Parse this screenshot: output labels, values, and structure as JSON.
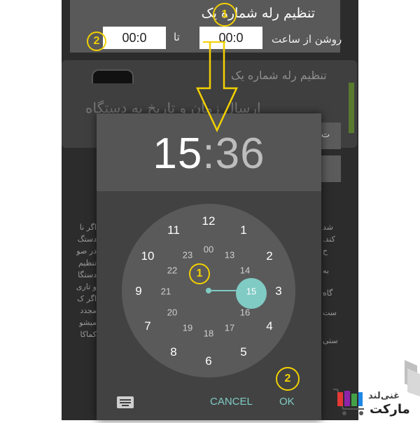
{
  "header": {
    "title": "تنظیم رله شماره یک",
    "from_label": "روشن از ساعت",
    "to_label": "تا",
    "from_time": "00:0",
    "to_time": "00:0"
  },
  "background": {
    "card_title": "تنظیم رله شماره یک",
    "card_subtitle": "ارسال زمان و تاریخ به دستگاه",
    "button_partial": "ت",
    "side_text": [
      "اگر نا",
      "دستگ",
      "در صو",
      "تنظیم",
      "دستگا",
      "و تاری",
      "اگر ک",
      "مجدد",
      "میشو",
      "کماکا"
    ],
    "right_text": [
      "شد",
      "کند.",
      "ح",
      "به",
      "گاه",
      "ست",
      "ستی"
    ]
  },
  "time_picker": {
    "hour": "15",
    "separator": ":",
    "minute": "36",
    "outer_numbers": [
      "12",
      "1",
      "2",
      "3",
      "4",
      "5",
      "6",
      "7",
      "8",
      "9",
      "10",
      "11"
    ],
    "inner_numbers": [
      "00",
      "13",
      "14",
      "15",
      "16",
      "17",
      "18",
      "19",
      "20",
      "21",
      "22",
      "23"
    ],
    "selected_value": "15",
    "cancel_label": "CANCEL",
    "ok_label": "OK",
    "accent_color": "#80cbc4"
  },
  "annotations": {
    "marker_1": "1",
    "marker_2": "2",
    "color": "#f2d000"
  },
  "logo": {
    "line1": "غنی‌لند",
    "line2": "مارکت"
  }
}
